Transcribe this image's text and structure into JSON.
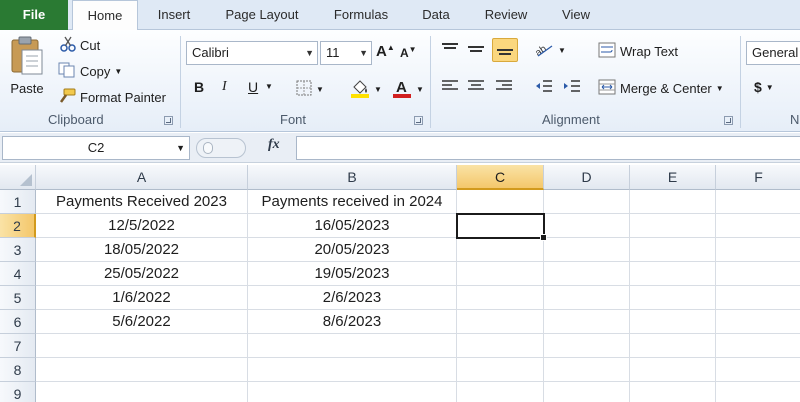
{
  "tabs": [
    "File",
    "Home",
    "Insert",
    "Page Layout",
    "Formulas",
    "Data",
    "Review",
    "View"
  ],
  "clipboard": {
    "paste": "Paste",
    "cut": "Cut",
    "copy": "Copy",
    "format_painter": "Format Painter",
    "label": "Clipboard"
  },
  "font": {
    "name": "Calibri",
    "size": "11",
    "bold": "B",
    "italic": "I",
    "underline": "U",
    "label": "Font"
  },
  "alignment": {
    "wrap_text": "Wrap Text",
    "merge_center": "Merge & Center",
    "label": "Alignment"
  },
  "number": {
    "format": "General",
    "currency": "$",
    "label_partial": "N"
  },
  "formula_bar": {
    "name_box": "C2",
    "fx": "fx",
    "content": ""
  },
  "sheet": {
    "columns": [
      "A",
      "B",
      "C",
      "D",
      "E",
      "F"
    ],
    "rows": [
      "1",
      "2",
      "3",
      "4",
      "5",
      "6",
      "7",
      "8",
      "9"
    ],
    "active_cell": "C2",
    "cells": [
      [
        "Payments Received 2023",
        "Payments received in 2024",
        "",
        "",
        "",
        ""
      ],
      [
        "12/5/2022",
        "16/05/2023",
        "",
        "",
        "",
        ""
      ],
      [
        "18/05/2022",
        "20/05/2023",
        "",
        "",
        "",
        ""
      ],
      [
        "25/05/2022",
        "19/05/2023",
        "",
        "",
        "",
        ""
      ],
      [
        "1/6/2022",
        "2/6/2023",
        "",
        "",
        "",
        ""
      ],
      [
        "5/6/2022",
        "8/6/2023",
        "",
        "",
        "",
        ""
      ],
      [
        "",
        "",
        "",
        "",
        "",
        ""
      ],
      [
        "",
        "",
        "",
        "",
        "",
        ""
      ],
      [
        "",
        "",
        "",
        "",
        "",
        ""
      ]
    ]
  },
  "colors": {
    "file_tab": "#2a7a33",
    "header_active": "#f4c76b",
    "ribbon_bg": "#e6eef8",
    "font_color_accent": "#d11f1f",
    "highlight_accent": "#ffe100"
  }
}
